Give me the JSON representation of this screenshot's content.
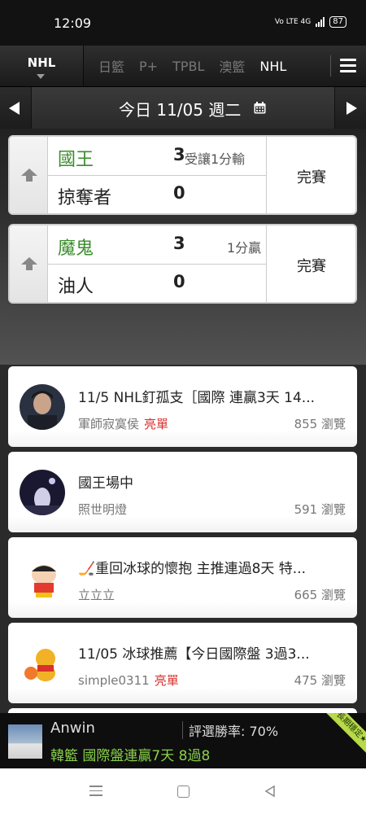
{
  "status_bar": {
    "time": "12:09",
    "network": "Vo LTE 4G",
    "battery": "87"
  },
  "tabs": {
    "active": "NHL",
    "items": [
      {
        "label": "日籃",
        "highlight": false
      },
      {
        "label": "P+",
        "highlight": false
      },
      {
        "label": "TPBL",
        "highlight": false
      },
      {
        "label": "澳籃",
        "highlight": false
      },
      {
        "label": "NHL",
        "highlight": true
      }
    ]
  },
  "date_bar": {
    "label": "今日 11/05 週二"
  },
  "games": [
    {
      "team1": "國王",
      "score1": "3",
      "spread1": "受讓1分輸",
      "team2": "掠奪者",
      "score2": "0",
      "status": "完賽"
    },
    {
      "team1": "魔鬼",
      "score1": "3",
      "spread1": "1分贏",
      "team2": "油人",
      "score2": "0",
      "status": "完賽"
    }
  ],
  "posts": [
    {
      "title": "11/5 NHL釘孤支［國際 連贏3天 14...",
      "author": "軍師寂寞侯",
      "tag": "亮單",
      "views": "855 瀏覽",
      "avatar": "man-portrait-avatar"
    },
    {
      "title": "國王場中",
      "author": "照世明燈",
      "tag": "",
      "views": "591 瀏覽",
      "avatar": "night-scene-avatar"
    },
    {
      "title": "🏒重回冰球的懷抱 主推連過8天 特...",
      "author": "立立立",
      "tag": "",
      "views": "665 瀏覽",
      "avatar": "cartoon-boy-avatar"
    },
    {
      "title": "11/05 冰球推薦【今日國際盤 3過3...",
      "author": "simple0311",
      "tag": "亮單",
      "views": "475 瀏覽",
      "avatar": "cartoon-bear-avatar"
    }
  ],
  "banner": {
    "name": "Anwin",
    "rate": "評選勝率: 70%",
    "subtitle": "韓籃 國際盤連贏7天 8過8",
    "ribbon": "長期穩定"
  },
  "colors": {
    "win": "#3b8c2c",
    "tag": "#d9302c",
    "banner_sub": "#8ad04a",
    "ribbon": "#b7d94a"
  }
}
